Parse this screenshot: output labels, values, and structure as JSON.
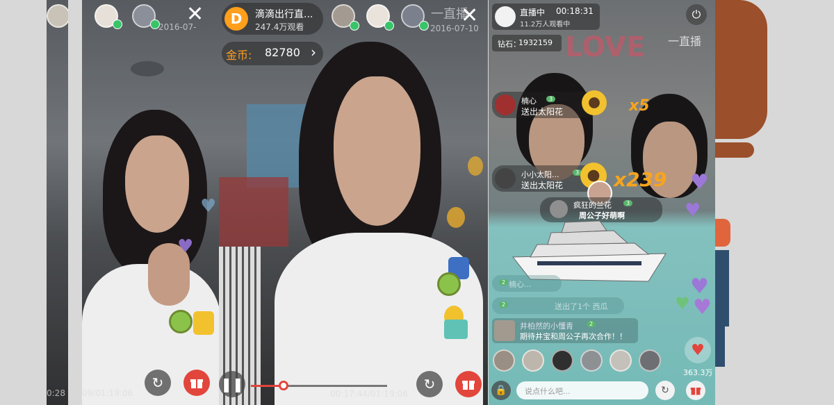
{
  "colors": {
    "accent_orange": "#ff9f1c",
    "gift_red": "#e2453c",
    "level_green": "#59b56b",
    "teal_water": "#86d0cc"
  },
  "panel_a": {
    "timestamp": "2016-07-",
    "time_left": "09/01:19:06",
    "time_left_partial": "0:28"
  },
  "panel_b": {
    "channel_name": "滴滴出行直...",
    "viewers": "247.4万观看",
    "coins_label": "金币:",
    "coins_value": "82780",
    "coins_arrow": "›",
    "live_label": "一直播",
    "timestamp": "2016-07-10",
    "playback_time": "00:17:44/01:19:06"
  },
  "panel_c": {
    "status_label": "直播中",
    "elapsed": "00:18:31",
    "viewers": "11.2万人观看中",
    "diamonds_label": "钻石：",
    "diamonds_value": "1932159",
    "live_label": "一直播",
    "gift_events": [
      {
        "user": "楠心",
        "level": "3",
        "action": "送出太阳花",
        "combo": "x5"
      },
      {
        "user": "小小太阳...",
        "level": "3",
        "action": "送出太阳花",
        "combo": "x239"
      }
    ],
    "yacht_sender": {
      "user": "疯狂的兰花",
      "level": "3",
      "message": "周公子好萌啊"
    },
    "chat": [
      {
        "user": "",
        "level": "2",
        "text": "楠心..."
      },
      {
        "user": "",
        "level": "2",
        "text": "送出了1个 西瓜"
      },
      {
        "user": "井柏然的小懂青",
        "level": "2",
        "text": "期待井宝和周公子再次合作！！"
      }
    ],
    "input_placeholder": "说点什么吧...",
    "like_count": "363.3万"
  }
}
